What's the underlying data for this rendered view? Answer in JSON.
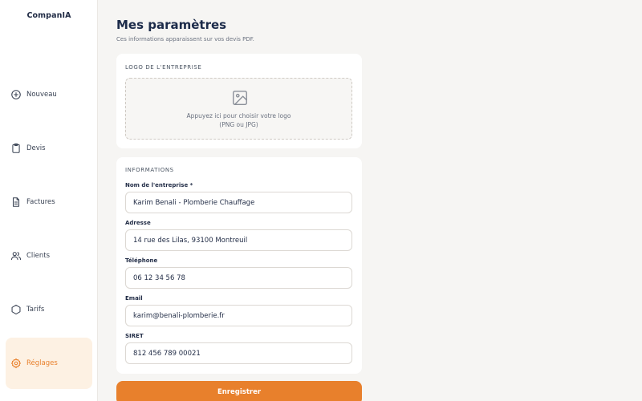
{
  "app": {
    "brand": "CompanIA"
  },
  "sidebar": {
    "items": [
      {
        "label": "Nouveau",
        "icon": "plus-circle-icon"
      },
      {
        "label": "Devis",
        "icon": "clipboard-icon"
      },
      {
        "label": "Factures",
        "icon": "document-icon"
      },
      {
        "label": "Clients",
        "icon": "users-icon"
      },
      {
        "label": "Tarifs",
        "icon": "hexagon-icon"
      },
      {
        "label": "Réglages",
        "icon": "gear-icon",
        "active": true
      }
    ]
  },
  "page": {
    "title": "Mes paramètres",
    "subtitle": "Ces informations apparaissent sur vos devis PDF."
  },
  "logo_section": {
    "label": "LOGO DE L'ENTREPRISE",
    "hint_line1": "Appuyez ici pour choisir votre logo",
    "hint_line2": "(PNG ou JPG)"
  },
  "info_section": {
    "label": "INFORMATIONS",
    "fields": [
      {
        "label": "Nom de l'entreprise *",
        "value": "Karim Benali - Plomberie Chauffage"
      },
      {
        "label": "Adresse",
        "value": "14 rue des Lilas, 93100 Montreuil"
      },
      {
        "label": "Téléphone",
        "value": "06 12 34 56 78"
      },
      {
        "label": "Email",
        "value": "karim@benali-plomberie.fr"
      },
      {
        "label": "SIRET",
        "value": "812 456 789 00021"
      }
    ]
  },
  "actions": {
    "save_label": "Enregistrer"
  },
  "colors": {
    "accent": "#e8802c",
    "active_bg": "#fdf1e3",
    "title": "#1c2b4a",
    "background": "#f6f5f3"
  }
}
